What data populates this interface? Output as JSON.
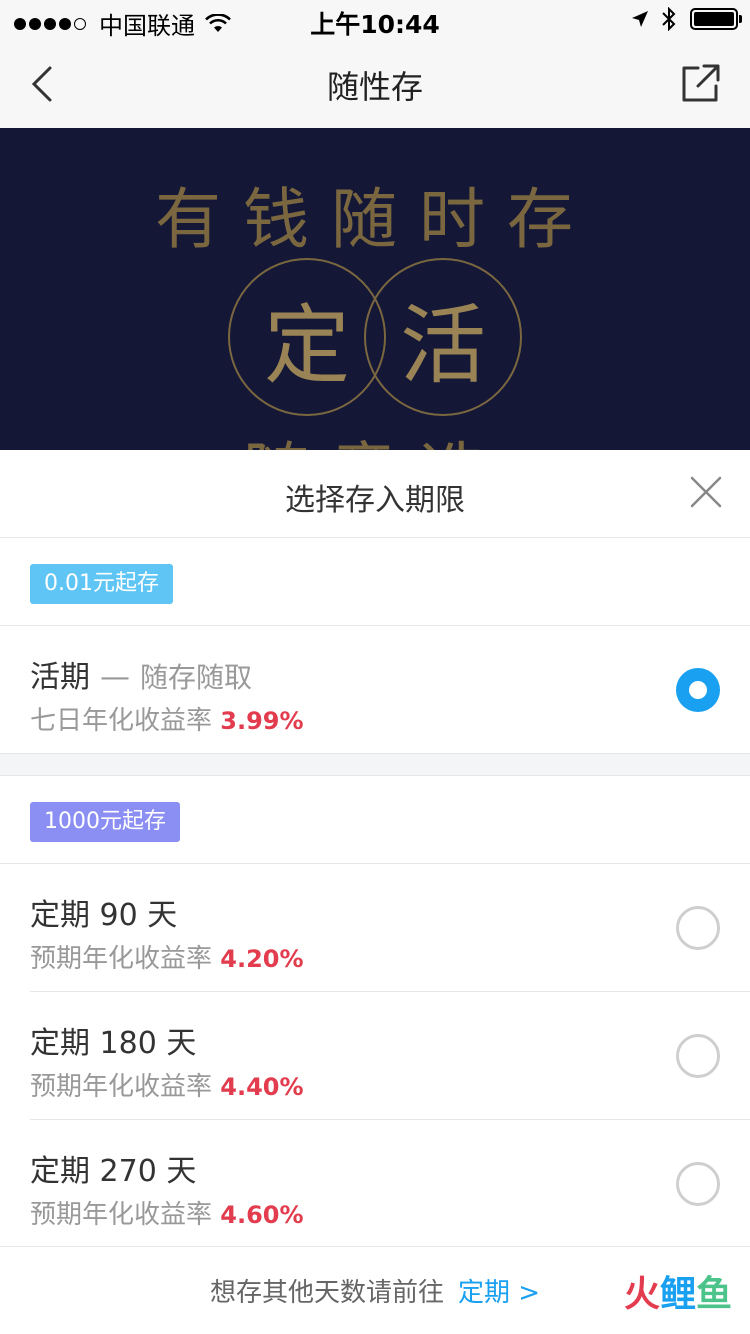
{
  "status_bar": {
    "carrier": "中国联通",
    "time": "上午10:44"
  },
  "nav": {
    "title": "随性存"
  },
  "banner": {
    "slogan": "有钱随时存",
    "circle_left": "定",
    "circle_right": "活",
    "sub_partial": "随意选"
  },
  "sheet": {
    "title": "选择存入期限",
    "groups": [
      {
        "tag": "0.01元起存",
        "options": [
          {
            "title": "活期",
            "dash": "—",
            "desc": "随存随取",
            "rate_label": "七日年化收益率",
            "rate": "3.99%",
            "selected": true
          }
        ]
      },
      {
        "tag": "1000元起存",
        "options": [
          {
            "title": "定期 90 天",
            "rate_label": "预期年化收益率",
            "rate": "4.20%",
            "selected": false
          },
          {
            "title": "定期 180 天",
            "rate_label": "预期年化收益率",
            "rate": "4.40%",
            "selected": false
          },
          {
            "title": "定期 270 天",
            "rate_label": "预期年化收益率",
            "rate": "4.60%",
            "selected": false
          }
        ]
      }
    ],
    "footer_text": "想存其他天数请前往",
    "footer_link": "定期 >"
  },
  "watermark": {
    "c1": "火",
    "c2": "鲤",
    "c3": "鱼"
  },
  "colors": {
    "accent": "#1aa0f0",
    "rate": "#e23c4e",
    "banner_bg": "#141836",
    "gold": "#7a6740"
  }
}
